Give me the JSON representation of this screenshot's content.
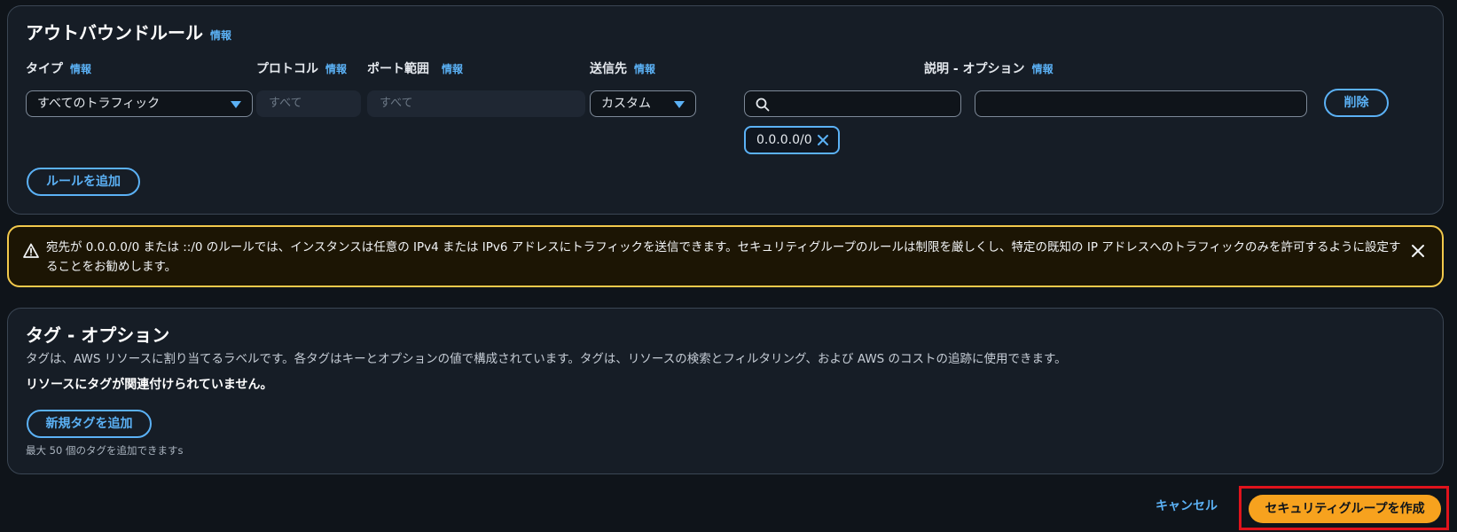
{
  "outbound": {
    "title": "アウトバウンドルール",
    "info": "情報",
    "columns": {
      "type": "タイプ",
      "protocol": "プロトコル",
      "port_range": "ポート範囲",
      "destination": "送信先",
      "description": "説明 - オプション"
    },
    "rule": {
      "type_value": "すべてのトラフィック",
      "protocol_value": "すべて",
      "port_value": "すべて",
      "destination_type": "カスタム",
      "destination_search_value": "",
      "destination_token": "0.0.0.0/0",
      "description_value": "",
      "delete_label": "削除"
    },
    "add_rule_label": "ルールを追加"
  },
  "warning": {
    "text": "宛先が 0.0.0.0/0 または ::/0 のルールでは、インスタンスは任意の IPv4 または IPv6 アドレスにトラフィックを送信できます。セキュリティグループのルールは制限を厳しくし、特定の既知の IP アドレスへのトラフィックのみを許可するように設定することをお勧めします。"
  },
  "tags": {
    "title": "タグ - オプション",
    "description": "タグは、AWS リソースに割り当てるラベルです。各タグはキーとオプションの値で構成されています。タグは、リソースの検索とフィルタリング、および AWS のコストの追跡に使用できます。",
    "empty_message": "リソースにタグが関連付けられていません。",
    "add_tag_label": "新規タグを追加",
    "limit_hint": "最大 50 個のタグを追加できますs"
  },
  "footer": {
    "cancel_label": "キャンセル",
    "create_label": "セキュリティグループを作成"
  },
  "colors": {
    "accent": "#5bb1f5",
    "primary_button": "#f7a21e",
    "warning_border": "#f2c94c",
    "highlight_box": "#e0131c"
  }
}
